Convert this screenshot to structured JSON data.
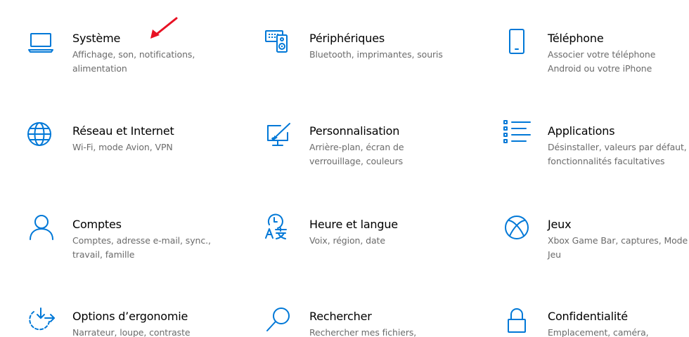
{
  "accent_color": "#0078d7",
  "annotation_color": "#e81123",
  "tiles": [
    {
      "icon": "laptop-icon",
      "title": "Système",
      "desc1": "Affichage, son, notifications,",
      "desc2": "alimentation"
    },
    {
      "icon": "devices-icon",
      "title": "Périphériques",
      "desc1": "Bluetooth, imprimantes, souris",
      "desc2": ""
    },
    {
      "icon": "phone-icon",
      "title": "Téléphone",
      "desc1": "Associer votre téléphone",
      "desc2": "Android ou votre iPhone"
    },
    {
      "icon": "globe-icon",
      "title": "Réseau et Internet",
      "desc1": "Wi-Fi, mode Avion, VPN",
      "desc2": ""
    },
    {
      "icon": "personalization-icon",
      "title": "Personnalisation",
      "desc1": "Arrière-plan, écran de",
      "desc2": "verrouillage, couleurs"
    },
    {
      "icon": "apps-list-icon",
      "title": "Applications",
      "desc1": "Désinstaller, valeurs par défaut,",
      "desc2": "fonctionnalités facultatives"
    },
    {
      "icon": "person-icon",
      "title": "Comptes",
      "desc1": "Comptes, adresse e-mail, sync.,",
      "desc2": "travail, famille"
    },
    {
      "icon": "time-language-icon",
      "title": "Heure et langue",
      "desc1": "Voix, région, date",
      "desc2": ""
    },
    {
      "icon": "xbox-icon",
      "title": "Jeux",
      "desc1": "Xbox Game Bar, captures, Mode",
      "desc2": "Jeu"
    },
    {
      "icon": "ease-of-access-icon",
      "title": "Options d’ergonomie",
      "desc1": "Narrateur, loupe, contraste",
      "desc2": ""
    },
    {
      "icon": "search-icon",
      "title": "Rechercher",
      "desc1": "Rechercher mes fichiers,",
      "desc2": ""
    },
    {
      "icon": "lock-icon",
      "title": "Confidentialité",
      "desc1": "Emplacement, caméra,",
      "desc2": ""
    }
  ]
}
